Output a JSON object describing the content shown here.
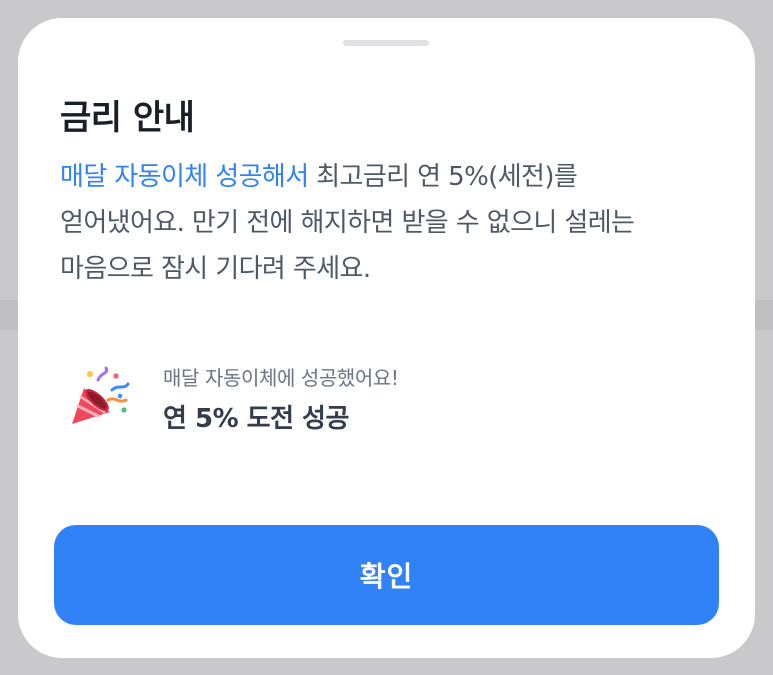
{
  "dialog": {
    "title": "금리 안내",
    "description": {
      "highlight": "매달 자동이체 성공해서",
      "line1_rest": " 최고금리 연 5%(세전)를",
      "line2": "얻어냈어요. 만기 전에 해지하면 받을 수 없으니 설레는",
      "line3": "마음으로 잠시 기다려 주세요."
    },
    "achievement": {
      "icon": "party-popper-icon",
      "subtitle": "매달 자동이체에 성공했어요!",
      "headline": "연 5% 도전 성공"
    },
    "confirm_label": "확인"
  },
  "colors": {
    "accent": "#3182f6",
    "title": "#191f28",
    "body_text": "#4e5968",
    "backdrop": "#c9c9cb",
    "sheet": "#ffffff"
  }
}
